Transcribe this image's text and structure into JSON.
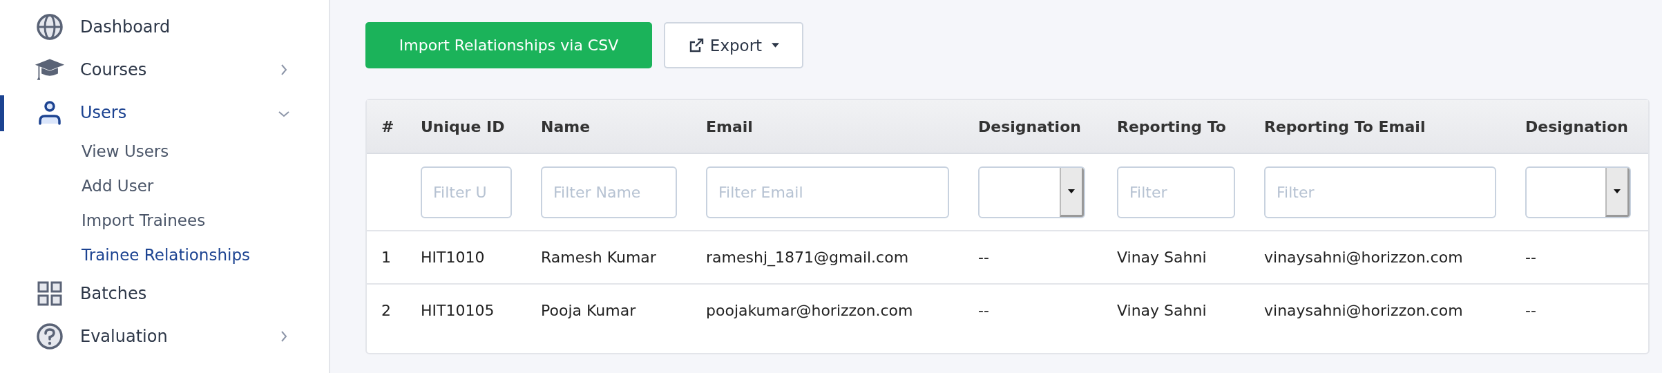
{
  "sidebar": {
    "items": [
      {
        "label": "Dashboard",
        "selected": false
      },
      {
        "label": "Courses",
        "selected": false,
        "expanded": false
      },
      {
        "label": "Users",
        "selected": true,
        "expanded": true,
        "children": [
          {
            "label": "View Users",
            "selected": false
          },
          {
            "label": "Add User",
            "selected": false
          },
          {
            "label": "Import Trainees",
            "selected": false
          },
          {
            "label": "Trainee Relationships",
            "selected": true
          }
        ]
      },
      {
        "label": "Batches",
        "selected": false
      },
      {
        "label": "Evaluation",
        "selected": false,
        "expanded": false
      }
    ]
  },
  "toolbar": {
    "import_button": "Import Relationships via CSV",
    "export_button": "Export"
  },
  "table": {
    "columns": [
      "#",
      "Unique ID",
      "Name",
      "Email",
      "Designation",
      "Reporting To",
      "Reporting To Email",
      "Designation"
    ],
    "filters": [
      {
        "kind": "none"
      },
      {
        "kind": "input",
        "placeholder": "Filter U"
      },
      {
        "kind": "input",
        "placeholder": "Filter Name"
      },
      {
        "kind": "input",
        "placeholder": "Filter Email"
      },
      {
        "kind": "select"
      },
      {
        "kind": "input",
        "placeholder": "Filter"
      },
      {
        "kind": "input",
        "placeholder": "Filter"
      },
      {
        "kind": "select"
      }
    ],
    "rows": [
      [
        "1",
        "HIT1010",
        "Ramesh Kumar",
        "rameshj_1871@gmail.com",
        "--",
        "Vinay Sahni",
        "vinaysahni@horizzon.com",
        "--"
      ],
      [
        "2",
        "HIT10105",
        "Pooja Kumar",
        "poojakumar@horizzon.com",
        "--",
        "Vinay Sahni",
        "vinaysahni@horizzon.com",
        "--"
      ]
    ]
  }
}
